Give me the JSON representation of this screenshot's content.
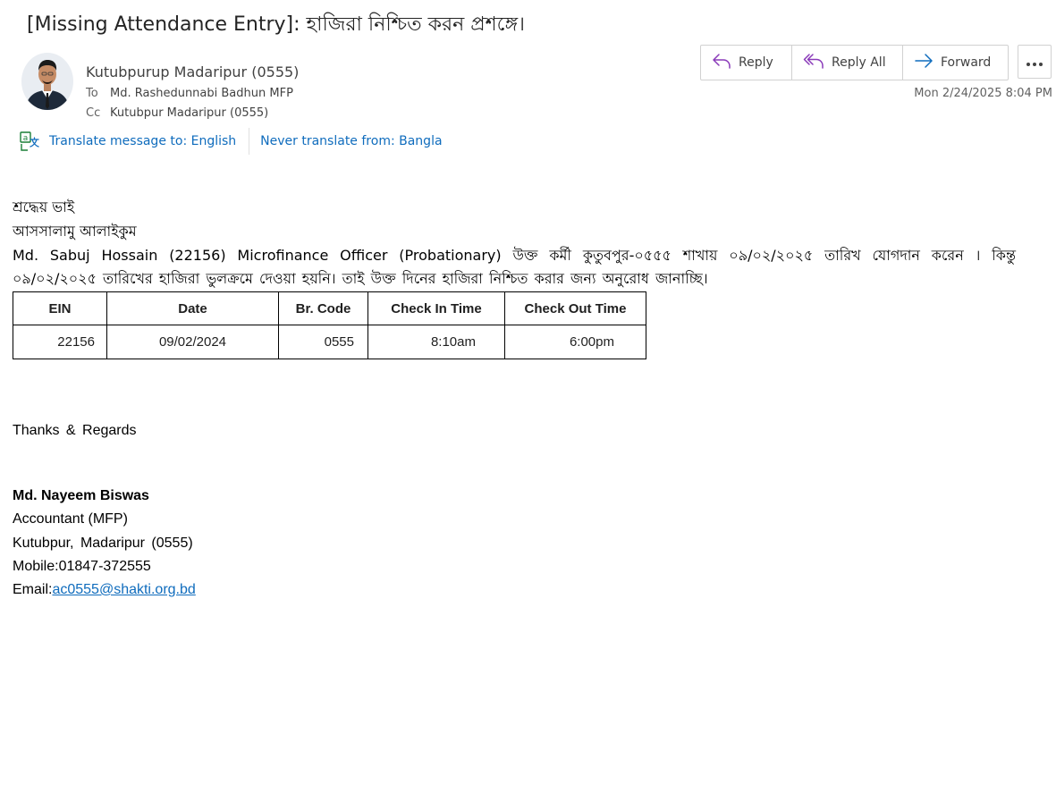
{
  "subject": "[Missing Attendance Entry]: হাজিরা নিশ্চিত করন প্রশঙ্গে।",
  "sender": {
    "name": "Kutubpurup Madaripur (0555)"
  },
  "recipients": {
    "to_label": "To",
    "to": "Md. Rashedunnabi Badhun MFP",
    "cc_label": "Cc",
    "cc": "Kutubpur Madaripur (0555)"
  },
  "actions": {
    "reply": "Reply",
    "reply_all": "Reply All",
    "forward": "Forward"
  },
  "timestamp": "Mon 2/24/2025 8:04 PM",
  "translate": {
    "translate_to": "Translate message to: English",
    "never_translate": "Never translate from: Bangla"
  },
  "body": {
    "salutation": "শ্রদ্ধেয়  ভাই",
    "greeting": "আসসালামু  আলাইকুম",
    "paragraph": "Md. Sabuj Hossain (22156) Microfinance Officer (Probationary) উক্ত কর্মী কুতুবপুর-০৫৫৫ শাখায় ০৯/০২/২০২৫ তারিখ যোগদান করেন । কিন্তু ০৯/০২/২০২৫ তারিখের হাজিরা ভুলক্রমে দেওয়া হয়নি। তাই উক্ত দিনের হাজিরা নিশ্চিত করার জন্য অনুরোধ জানাচ্ছি।"
  },
  "table": {
    "headers": [
      "EIN",
      "Date",
      "Br. Code",
      "Check In Time",
      "Check Out Time"
    ],
    "row": [
      "22156",
      "09/02/2024",
      "0555",
      "8:10am",
      "6:00pm"
    ]
  },
  "signature": {
    "closing": "Thanks  &  Regards",
    "name": "Md. Nayeem Biswas",
    "title": "Accountant (MFP)",
    "branch": "Kutubpur, Madaripur (0555)",
    "mobile": "Mobile:01847-372555",
    "email_label": "Email:",
    "email": "ac0555@shakti.org.bd"
  },
  "colors": {
    "link": "#0f6cbd",
    "reply_icon": "#8a3ab9",
    "forward_icon": "#0f6cbd"
  },
  "icons": {
    "reply": "reply-icon",
    "reply_all": "reply-all-icon",
    "forward": "forward-icon",
    "more": "more-horizontal-icon",
    "translate": "translate-icon"
  }
}
